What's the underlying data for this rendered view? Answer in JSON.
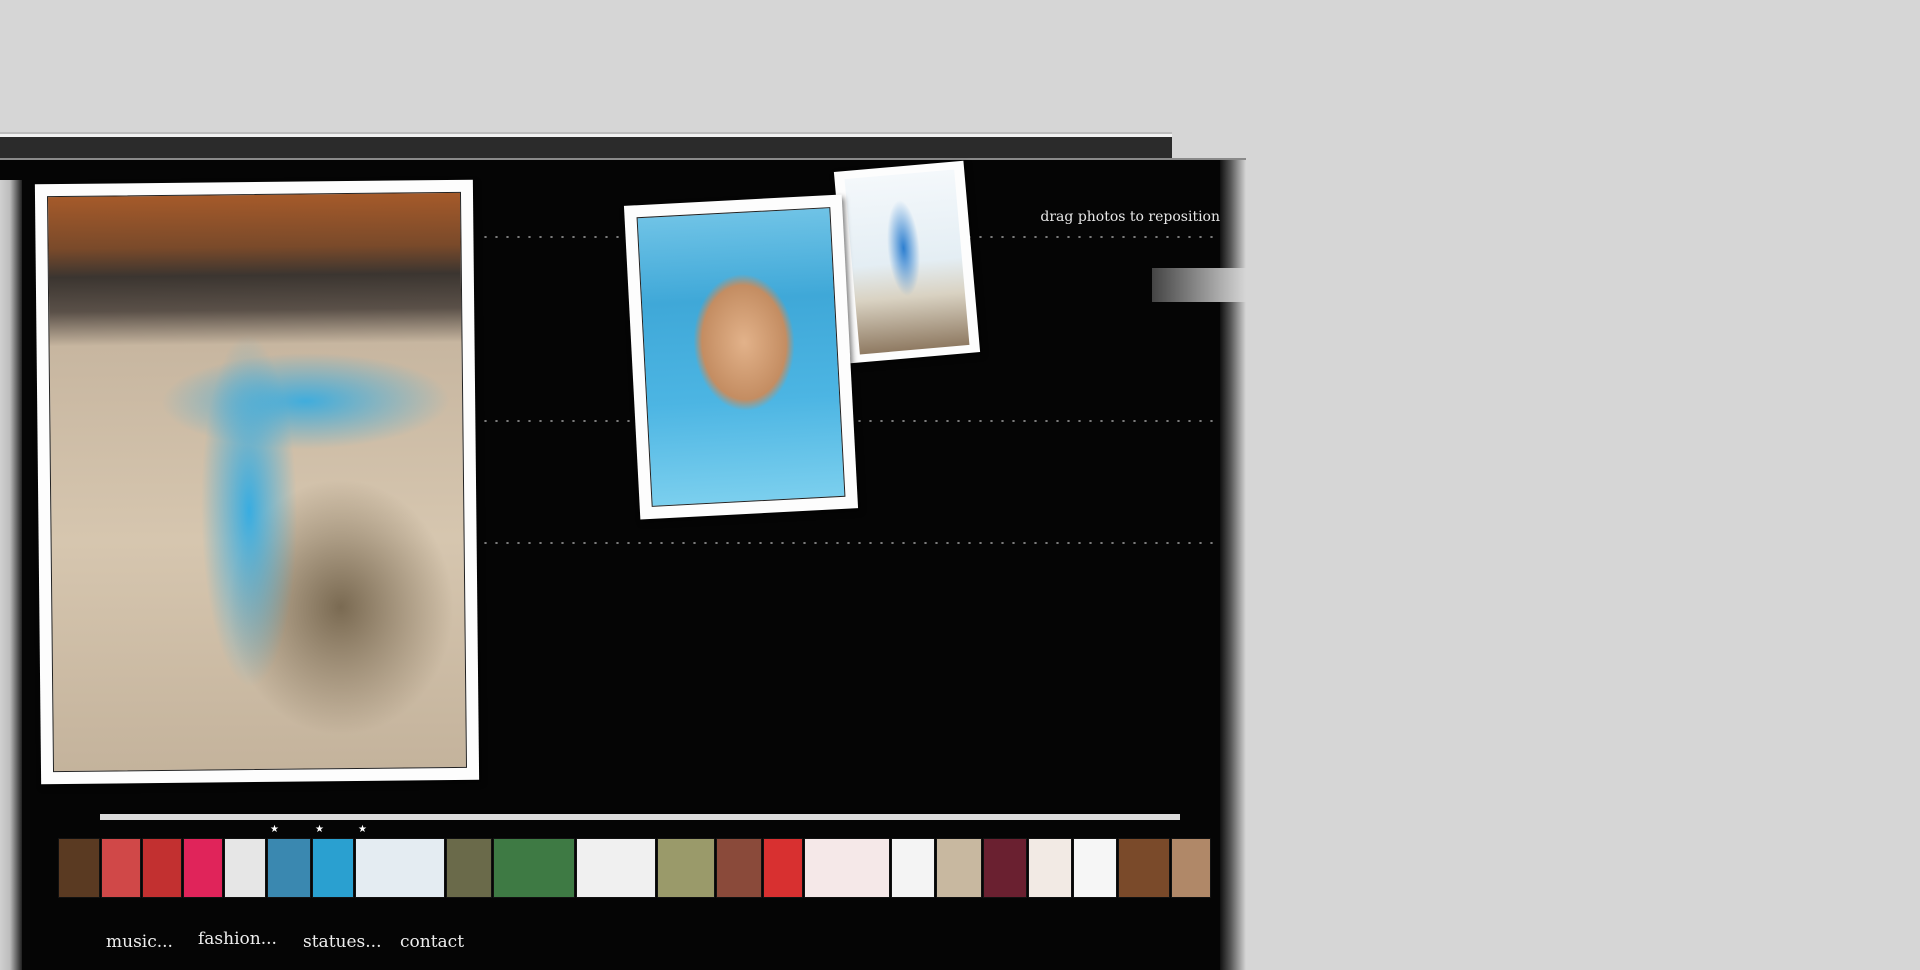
{
  "hint": "drag photos to reposition",
  "photos": [
    {
      "name": "beach-photo"
    },
    {
      "name": "face-photo"
    },
    {
      "name": "chair-photo"
    }
  ],
  "thumbnails": [
    {
      "color": "#5a3a22"
    },
    {
      "color": "#d04848"
    },
    {
      "color": "#c23030"
    },
    {
      "color": "#e0245a"
    },
    {
      "color": "#e6e6e6"
    },
    {
      "color": "#3a88b0"
    },
    {
      "color": "#2aa0d0"
    },
    {
      "color": "#e4ecf2"
    },
    {
      "color": "#6a6a4a"
    },
    {
      "color": "#3e7a44"
    },
    {
      "color": "#f0f0f0"
    },
    {
      "color": "#9a9a6a"
    },
    {
      "color": "#8a4a3a"
    },
    {
      "color": "#d83030"
    },
    {
      "color": "#f5e8e8"
    },
    {
      "color": "#f4f4f4"
    },
    {
      "color": "#c8b8a0"
    },
    {
      "color": "#6a2030"
    },
    {
      "color": "#f2eae4"
    },
    {
      "color": "#f6f6f6"
    },
    {
      "color": "#7a4a2a"
    },
    {
      "color": "#b08868"
    }
  ],
  "nav": {
    "music": "music...",
    "fashion": "fashion...",
    "statues": "statues...",
    "contact": "contact"
  }
}
